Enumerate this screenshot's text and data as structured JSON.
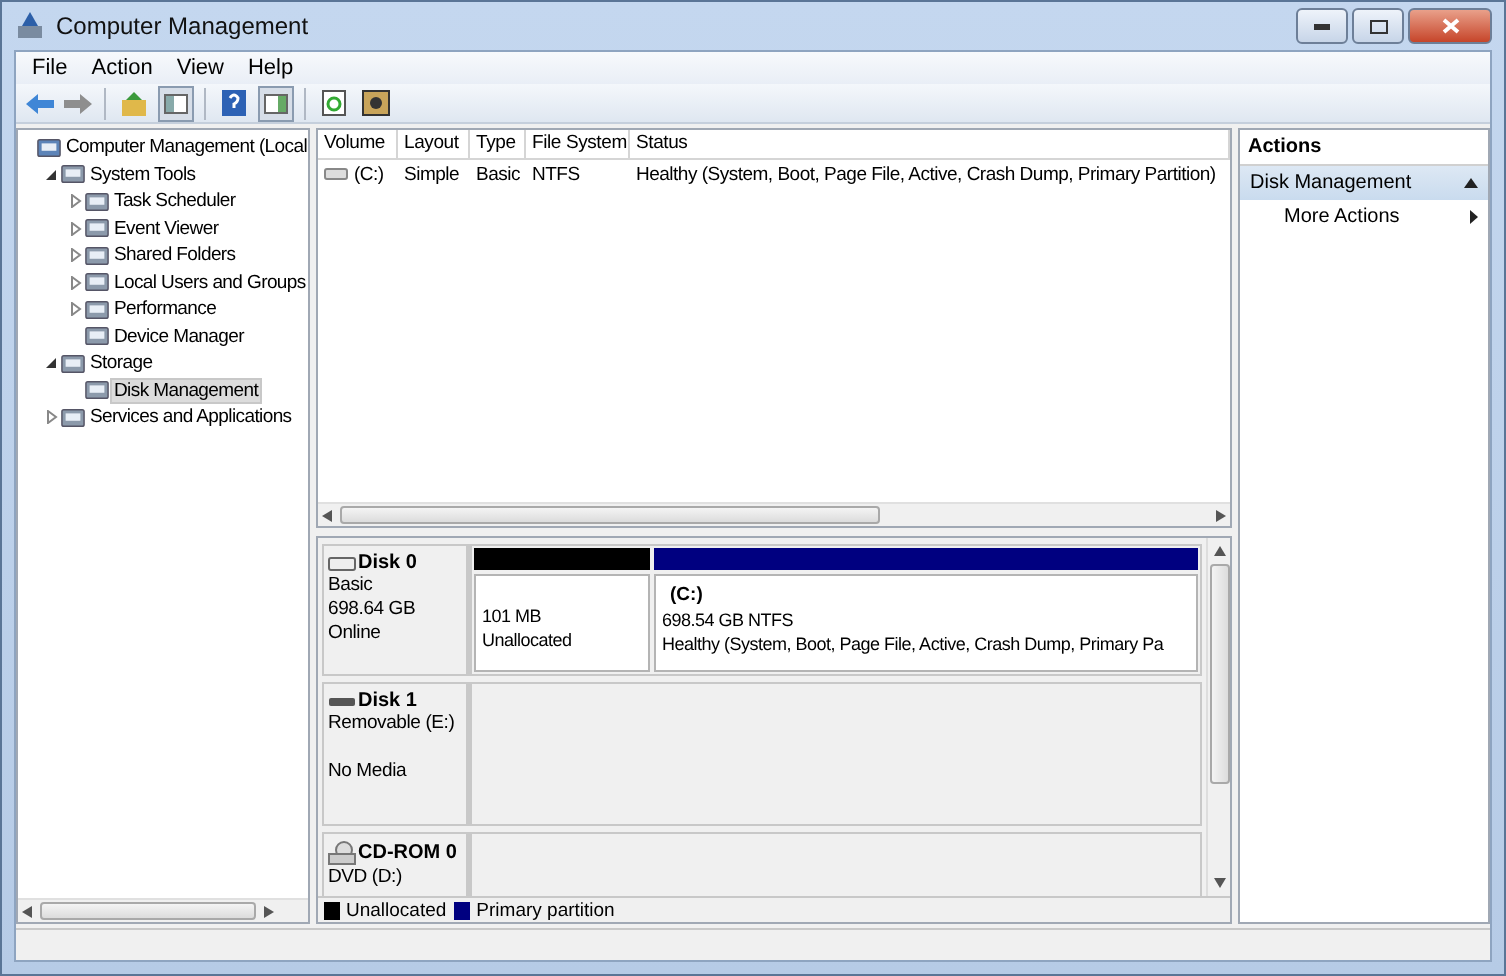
{
  "window": {
    "title": "Computer Management"
  },
  "menu": [
    "File",
    "Action",
    "View",
    "Help"
  ],
  "tree": [
    {
      "label": "Computer Management (Local",
      "selected": false,
      "children": [
        {
          "label": "System Tools",
          "expanded": true,
          "selected": false,
          "children": [
            {
              "label": "Task Scheduler",
              "expanded": false,
              "selected": false
            },
            {
              "label": "Event Viewer",
              "expanded": false,
              "selected": false
            },
            {
              "label": "Shared Folders",
              "expanded": false,
              "selected": false
            },
            {
              "label": "Local Users and Groups",
              "expanded": false,
              "selected": false
            },
            {
              "label": "Performance",
              "expanded": false,
              "selected": false
            },
            {
              "label": "Device Manager",
              "selected": false
            }
          ]
        },
        {
          "label": "Storage",
          "expanded": true,
          "selected": false,
          "children": [
            {
              "label": "Disk Management",
              "selected": true
            }
          ]
        },
        {
          "label": "Services and Applications",
          "expanded": false,
          "selected": false
        }
      ]
    }
  ],
  "volume_table": {
    "columns": [
      "Volume",
      "Layout",
      "Type",
      "File System",
      "Status"
    ],
    "rows": [
      [
        "(C:)",
        "Simple",
        "Basic",
        "NTFS",
        "Healthy (System, Boot, Page File, Active, Crash Dump, Primary Partition)"
      ]
    ]
  },
  "disks": [
    {
      "kind": "hdd",
      "name": "Disk 0",
      "lines": [
        "Basic",
        "698.64 GB",
        "Online"
      ],
      "partitions": [
        {
          "kind": "unallocated",
          "color": "#000000",
          "lines": [
            "101 MB",
            "Unallocated"
          ]
        },
        {
          "kind": "primary",
          "color": "#000080",
          "name": "(C:)",
          "lines": [
            "698.54 GB NTFS",
            "Healthy (System, Boot, Page File, Active, Crash Dump, Primary Pa"
          ]
        }
      ]
    },
    {
      "kind": "removable",
      "name": "Disk 1",
      "lines": [
        "Removable (E:)"
      ],
      "note": "No Media"
    },
    {
      "kind": "cdrom",
      "name": "CD-ROM 0",
      "lines": [
        "DVD (D:)"
      ]
    }
  ],
  "legend": [
    {
      "label": "Unallocated",
      "color": "#000000"
    },
    {
      "label": "Primary partition",
      "color": "#000080"
    }
  ],
  "actions": {
    "title": "Actions",
    "sections": [
      {
        "label": "Disk Management",
        "expanded": true,
        "items": [
          "More Actions"
        ]
      }
    ]
  }
}
